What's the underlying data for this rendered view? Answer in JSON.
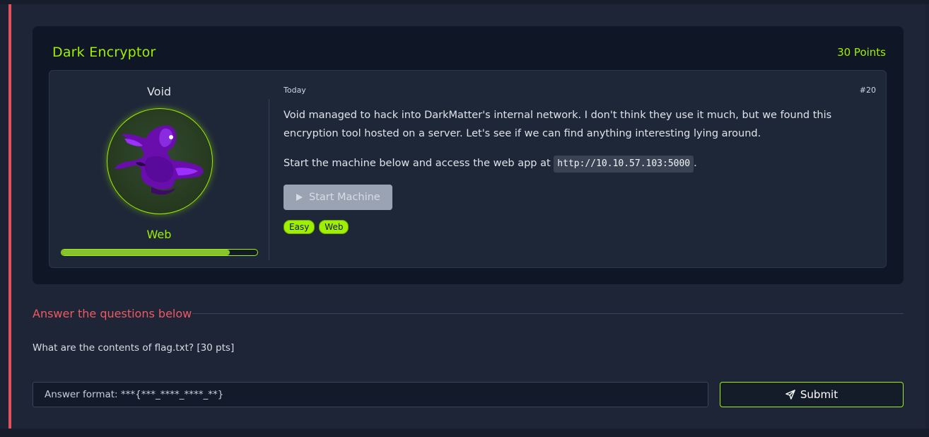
{
  "task": {
    "title": "Dark Encryptor",
    "points": "30 Points",
    "room_name": "Void",
    "category": "Web",
    "progress": 0.86,
    "date": "Today",
    "number": "#20",
    "description": "Void managed to hack into  DarkMatter's internal network. I don't think they use it much, but we found this encryption tool hosted on a server. Let's see if we can find anything interesting lying around.",
    "instruction_prefix": "Start the machine below and access the web app at ",
    "instruction_url": "http://10.10.57.103:5000",
    "instruction_suffix": ".",
    "start_button": "Start Machine",
    "tags": [
      "Easy",
      "Web"
    ]
  },
  "answers": {
    "header": "Answer the questions below",
    "question": "What are the contents of flag.txt? [30 pts]",
    "placeholder": "Answer format: ***{***_****_****_**}",
    "submit_label": "Submit"
  },
  "colors": {
    "accent": "#9fef00",
    "alert": "#ee5a63",
    "background": "#1c2233",
    "card": "#0f1626"
  },
  "icons": {
    "avatar": "purple-void-figure-avatar",
    "start": "play-icon",
    "submit": "paper-plane-icon"
  }
}
